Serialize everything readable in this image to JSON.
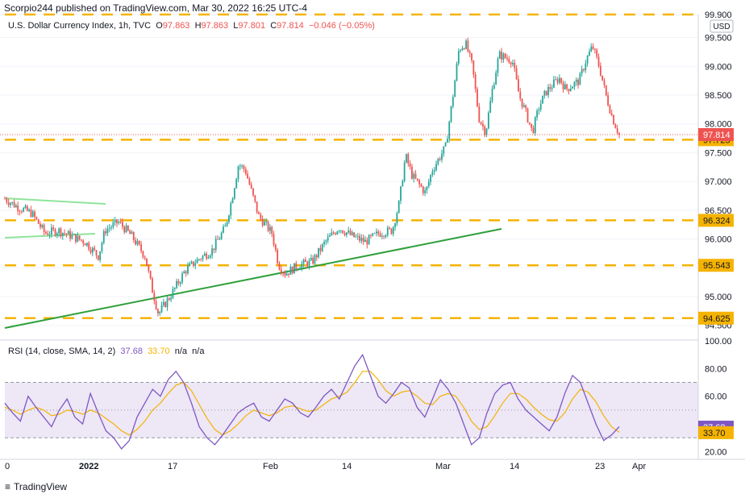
{
  "header": {
    "published": "Scorpio244 published on TradingView.com, Mar 30, 2022 16:25 UTC-4"
  },
  "legend": {
    "symbol": "U.S. Dollar Currency Index, 1h, TVC",
    "o_label": "O",
    "o": "97.863",
    "h_label": "H",
    "h": "97.863",
    "l_label": "L",
    "l": "97.801",
    "c_label": "C",
    "c": "97.814",
    "change": "−0.046 (−0.05%)"
  },
  "rsi_legend": {
    "name": "RSI (14, close, SMA, 14, 2)",
    "rsi": "37.68",
    "sma": "33.70",
    "na1": "n/a",
    "na2": "n/a"
  },
  "footer": {
    "brand": "TradingView",
    "logo": "tradingview-logo-icon"
  },
  "colors": {
    "up": "#26a69a",
    "down": "#ef5350",
    "support": "#f5b301",
    "trend": "#2e9f3a",
    "channel": "#8ee49a",
    "rsi": "#7e57c2",
    "rsi_sma": "#f5b301",
    "rsi_band": "#ede7f6"
  },
  "chart_data": [
    {
      "type": "candlestick",
      "title": "U.S. Dollar Currency Index, 1h, TVC",
      "currency_badge": "USD",
      "ylim": [
        94.3,
        99.9
      ],
      "y_ticks": [
        "94.500",
        "95.000",
        "95.500",
        "96.000",
        "96.500",
        "97.000",
        "97.500",
        "98.000",
        "98.500",
        "99.000",
        "99.500",
        "99.900"
      ],
      "x_ticks": [
        "0",
        "2022",
        "17",
        "Feb",
        "14",
        "Mar",
        "14",
        "23",
        "Apr"
      ],
      "last_price": "97.814",
      "support_levels": [
        {
          "value": 99.9,
          "label": ""
        },
        {
          "value": 97.725,
          "label": "97.725"
        },
        {
          "value": 96.324,
          "label": "96.324"
        },
        {
          "value": 95.543,
          "label": "95.543"
        },
        {
          "value": 94.625,
          "label": "94.625"
        }
      ],
      "price_path": [
        {
          "t": 0,
          "p": 96.7
        },
        {
          "t": 0.02,
          "p": 96.55
        },
        {
          "t": 0.04,
          "p": 96.45
        },
        {
          "t": 0.06,
          "p": 96.1
        },
        {
          "t": 0.08,
          "p": 96.15
        },
        {
          "t": 0.1,
          "p": 96.05
        },
        {
          "t": 0.12,
          "p": 95.95
        },
        {
          "t": 0.14,
          "p": 95.7
        },
        {
          "t": 0.15,
          "p": 96.15
        },
        {
          "t": 0.17,
          "p": 96.3
        },
        {
          "t": 0.19,
          "p": 96.05
        },
        {
          "t": 0.21,
          "p": 95.7
        },
        {
          "t": 0.22,
          "p": 95.15
        },
        {
          "t": 0.23,
          "p": 94.7
        },
        {
          "t": 0.25,
          "p": 95.05
        },
        {
          "t": 0.27,
          "p": 95.45
        },
        {
          "t": 0.29,
          "p": 95.65
        },
        {
          "t": 0.31,
          "p": 95.8
        },
        {
          "t": 0.33,
          "p": 96.2
        },
        {
          "t": 0.34,
          "p": 96.7
        },
        {
          "t": 0.35,
          "p": 97.3
        },
        {
          "t": 0.36,
          "p": 97.2
        },
        {
          "t": 0.38,
          "p": 96.4
        },
        {
          "t": 0.4,
          "p": 96.1
        },
        {
          "t": 0.41,
          "p": 95.55
        },
        {
          "t": 0.42,
          "p": 95.4
        },
        {
          "t": 0.44,
          "p": 95.55
        },
        {
          "t": 0.46,
          "p": 95.6
        },
        {
          "t": 0.48,
          "p": 95.95
        },
        {
          "t": 0.5,
          "p": 96.2
        },
        {
          "t": 0.52,
          "p": 96.05
        },
        {
          "t": 0.54,
          "p": 95.95
        },
        {
          "t": 0.56,
          "p": 96.1
        },
        {
          "t": 0.58,
          "p": 96.15
        },
        {
          "t": 0.59,
          "p": 96.6
        },
        {
          "t": 0.6,
          "p": 97.45
        },
        {
          "t": 0.61,
          "p": 97.1
        },
        {
          "t": 0.63,
          "p": 96.8
        },
        {
          "t": 0.64,
          "p": 97.2
        },
        {
          "t": 0.66,
          "p": 97.6
        },
        {
          "t": 0.67,
          "p": 98.4
        },
        {
          "t": 0.68,
          "p": 99.3
        },
        {
          "t": 0.69,
          "p": 99.4
        },
        {
          "t": 0.7,
          "p": 99.0
        },
        {
          "t": 0.71,
          "p": 98.1
        },
        {
          "t": 0.72,
          "p": 97.85
        },
        {
          "t": 0.73,
          "p": 98.6
        },
        {
          "t": 0.74,
          "p": 99.2
        },
        {
          "t": 0.76,
          "p": 99.1
        },
        {
          "t": 0.77,
          "p": 98.5
        },
        {
          "t": 0.78,
          "p": 98.2
        },
        {
          "t": 0.79,
          "p": 97.85
        },
        {
          "t": 0.8,
          "p": 98.3
        },
        {
          "t": 0.81,
          "p": 98.55
        },
        {
          "t": 0.83,
          "p": 98.8
        },
        {
          "t": 0.84,
          "p": 98.6
        },
        {
          "t": 0.86,
          "p": 98.75
        },
        {
          "t": 0.87,
          "p": 99.1
        },
        {
          "t": 0.88,
          "p": 99.35
        },
        {
          "t": 0.89,
          "p": 99.0
        },
        {
          "t": 0.9,
          "p": 98.5
        },
        {
          "t": 0.91,
          "p": 98.1
        },
        {
          "t": 0.92,
          "p": 97.81
        }
      ],
      "trendline_note": "rising trendline",
      "channel_note": "light green short channel"
    },
    {
      "type": "line",
      "title": "RSI (14, close, SMA, 14, 2)",
      "ylim": [
        15,
        100
      ],
      "y_ticks": [
        "20.00",
        "40.00",
        "60.00",
        "80.00",
        "100.00"
      ],
      "bands": [
        70,
        50,
        30
      ],
      "last_values": {
        "rsi": "37.68",
        "sma": "33.70"
      },
      "series": [
        {
          "name": "RSI",
          "values": [
            55,
            48,
            42,
            60,
            52,
            45,
            38,
            50,
            58,
            45,
            40,
            62,
            48,
            35,
            30,
            22,
            28,
            45,
            55,
            65,
            60,
            72,
            78,
            70,
            55,
            38,
            30,
            25,
            32,
            40,
            48,
            52,
            55,
            45,
            42,
            50,
            58,
            55,
            48,
            45,
            52,
            60,
            65,
            58,
            70,
            82,
            90,
            75,
            60,
            55,
            62,
            70,
            66,
            52,
            45,
            58,
            72,
            65,
            55,
            40,
            25,
            30,
            48,
            62,
            68,
            70,
            58,
            50,
            45,
            40,
            35,
            45,
            62,
            75,
            70,
            55,
            40,
            28,
            32,
            38
          ]
        },
        {
          "name": "SMA",
          "values": [
            52,
            50,
            47,
            50,
            52,
            50,
            46,
            47,
            50,
            49,
            47,
            50,
            48,
            44,
            40,
            35,
            32,
            36,
            42,
            50,
            55,
            62,
            68,
            70,
            64,
            54,
            44,
            36,
            32,
            35,
            40,
            46,
            50,
            48,
            46,
            48,
            52,
            53,
            51,
            49,
            50,
            54,
            58,
            60,
            63,
            70,
            78,
            78,
            72,
            64,
            60,
            63,
            64,
            60,
            55,
            54,
            60,
            62,
            60,
            52,
            42,
            36,
            38,
            46,
            55,
            62,
            62,
            58,
            52,
            47,
            43,
            42,
            48,
            58,
            65,
            63,
            56,
            46,
            38,
            34
          ]
        }
      ]
    }
  ]
}
